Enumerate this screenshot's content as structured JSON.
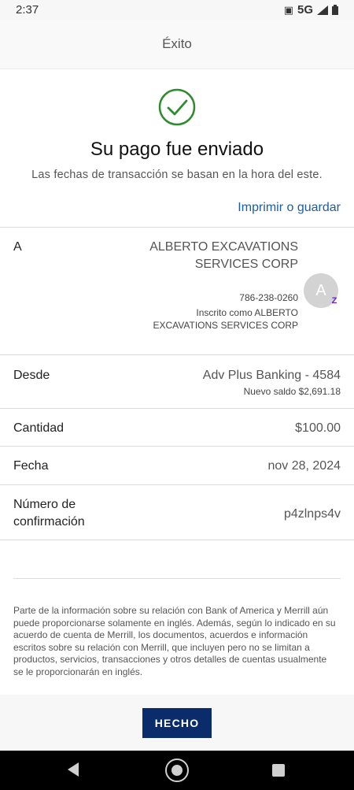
{
  "status_bar": {
    "time": "2:37",
    "network": "5G",
    "network_suffix": "ᵁ"
  },
  "header": {
    "title": "Éxito"
  },
  "success": {
    "title": "Su pago fue enviado",
    "note": "Las fechas de transacción se basan en la hora del este.",
    "print_link": "Imprimir o guardar",
    "icon": "check-circle-icon",
    "icon_color": "#2e8b2e"
  },
  "recipient": {
    "label": "A",
    "name": "ALBERTO EXCAVATIONS SERVICES CORP",
    "phone": "786-238-0260",
    "enrolled": "Inscrito como ALBERTO EXCAVATIONS SERVICES CORP",
    "avatar_initial": "A",
    "badge": "Z"
  },
  "from": {
    "label": "Desde",
    "account": "Adv Plus Banking - 4584",
    "new_balance": "Nuevo saldo $2,691.18"
  },
  "amount": {
    "label": "Cantidad",
    "value": "$100.00"
  },
  "date": {
    "label": "Fecha",
    "value": "nov 28, 2024"
  },
  "confirmation": {
    "label_line1": "Número de",
    "label_line2": "confirmación",
    "value": "p4zlnps4v"
  },
  "disclaimer": "Parte de la información sobre su relación con Bank of America y Merrill aún puede proporcionarse solamente en inglés. Además, según lo indicado en su acuerdo de cuenta de Merrill, los documentos, acuerdos e información escritos sobre su relación con Merrill, que incluyen pero no se limitan a productos, servicios, transacciones y otros detalles de cuentas usualmente se le proporcionarán en inglés.",
  "footer": {
    "done_label": "HECHO",
    "button_color": "#0b2c6b"
  },
  "colors": {
    "link": "#1d5ea0",
    "zelle": "#6d1ed4"
  }
}
